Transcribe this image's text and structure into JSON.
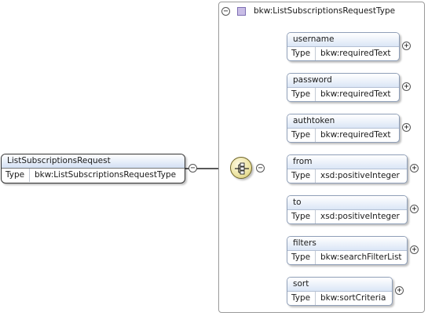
{
  "root": {
    "name": "ListSubscriptionsRequest",
    "type_key": "Type",
    "type_value": "bkw:ListSubscriptionsRequestType",
    "toggle": "−"
  },
  "complex_type": {
    "title": "bkw:ListSubscriptionsRequestType",
    "toggle": "−"
  },
  "sequence": {
    "icon": "sequence-compositor-icon",
    "toggle": "−"
  },
  "elements": [
    {
      "name": "username",
      "type_key": "Type",
      "type_value": "bkw:requiredText",
      "toggle": "+"
    },
    {
      "name": "password",
      "type_key": "Type",
      "type_value": "bkw:requiredText",
      "toggle": "+"
    },
    {
      "name": "authtoken",
      "type_key": "Type",
      "type_value": "bkw:requiredText",
      "toggle": "+"
    },
    {
      "name": "from",
      "type_key": "Type",
      "type_value": "xsd:positiveInteger",
      "toggle": "+"
    },
    {
      "name": "to",
      "type_key": "Type",
      "type_value": "xsd:positiveInteger",
      "toggle": "+"
    },
    {
      "name": "filters",
      "type_key": "Type",
      "type_value": "bkw:searchFilterList",
      "toggle": "+"
    },
    {
      "name": "sort",
      "type_key": "Type",
      "type_value": "bkw:sortCriteria",
      "toggle": "+"
    }
  ],
  "colors": {
    "header_gradient_bottom": "#dbe6f6",
    "node_border": "#8f9fb8",
    "compositor_fill": "#ece3a2",
    "type_square": "#c9bde6"
  }
}
